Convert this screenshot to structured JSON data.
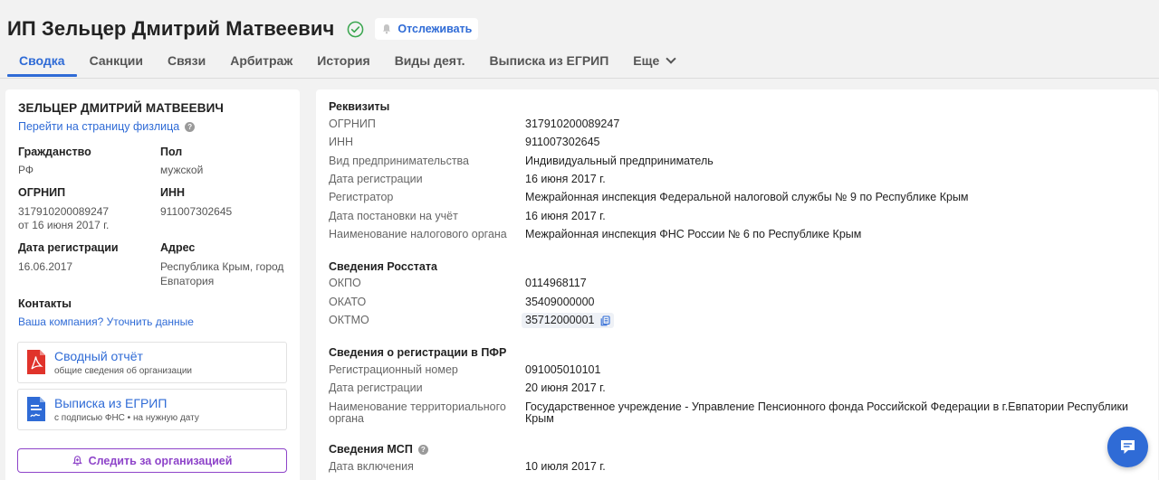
{
  "header": {
    "title": "ИП Зельцер Дмитрий Матвеевич",
    "follow_label": "Отслеживать",
    "accent": "#2f6bd6",
    "verified_color": "#3aa64f"
  },
  "tabs": [
    {
      "label": "Сводка",
      "active": true
    },
    {
      "label": "Санкции"
    },
    {
      "label": "Связи"
    },
    {
      "label": "Арбитраж"
    },
    {
      "label": "История"
    },
    {
      "label": "Виды деят."
    },
    {
      "label": "Выписка из ЕГРИП"
    },
    {
      "label": "Еще"
    }
  ],
  "left": {
    "name": "ЗЕЛЬЦЕР ДМИТРИЙ МАТВЕЕВИЧ",
    "person_link": "Перейти на страницу физлица",
    "citizenship_label": "Гражданство",
    "citizenship_value": "РФ",
    "sex_label": "Пол",
    "sex_value": "мужской",
    "ogrnip_label": "ОГРНИП",
    "ogrnip_value": "317910200089247",
    "ogrnip_date": "от 16 июня 2017 г.",
    "inn_label": "ИНН",
    "inn_value": "911007302645",
    "regdate_label": "Дата регистрации",
    "regdate_value": "16.06.2017",
    "address_label": "Адрес",
    "address_value": "Республика Крым, город Евпатория",
    "contacts_label": "Контакты",
    "contacts_link": "Ваша компания? Уточнить данные",
    "doc1_title": "Сводный отчёт",
    "doc1_sub": "общие сведения об организации",
    "doc2_title": "Выписка из ЕГРИП",
    "doc2_sub": "с подписью ФНС • на нужную дату",
    "watch_label": "Следить за организацией",
    "watch_color": "#8e44c9"
  },
  "right": {
    "rekv_title": "Реквизиты",
    "rekv": [
      {
        "k": "ОГРНИП",
        "v": "317910200089247"
      },
      {
        "k": "ИНН",
        "v": "911007302645"
      },
      {
        "k": "Вид предпринимательства",
        "v": "Индивидуальный предприниматель"
      },
      {
        "k": "Дата регистрации",
        "v": "16 июня 2017 г."
      },
      {
        "k": "Регистратор",
        "v": "Межрайонная инспекция Федеральной налоговой службы № 9 по Республике Крым"
      },
      {
        "k": "Дата постановки на учёт",
        "v": "16 июня 2017 г."
      },
      {
        "k": "Наименование налогового органа",
        "v": "Межрайонная инспекция ФНС России № 6 по Республике Крым"
      }
    ],
    "rosstat_title": "Сведения Росстата",
    "rosstat": [
      {
        "k": "ОКПО",
        "v": "0114968117"
      },
      {
        "k": "ОКАТО",
        "v": "35409000000"
      },
      {
        "k": "ОКТМО",
        "v": "35712000001"
      }
    ],
    "pfr_title": "Сведения о регистрации в ПФР",
    "pfr": [
      {
        "k": "Регистрационный номер",
        "v": "091005010101"
      },
      {
        "k": "Дата регистрации",
        "v": "20 июня 2017 г."
      },
      {
        "k": "Наименование территориального органа",
        "v": "Государственное учреждение - Управление Пенсионного фонда Российской Федерации в г.Евпатории Республики Крым"
      }
    ],
    "msp_title": "Сведения МСП",
    "msp": [
      {
        "k": "Дата включения",
        "v": "10 июля 2017 г."
      }
    ]
  }
}
